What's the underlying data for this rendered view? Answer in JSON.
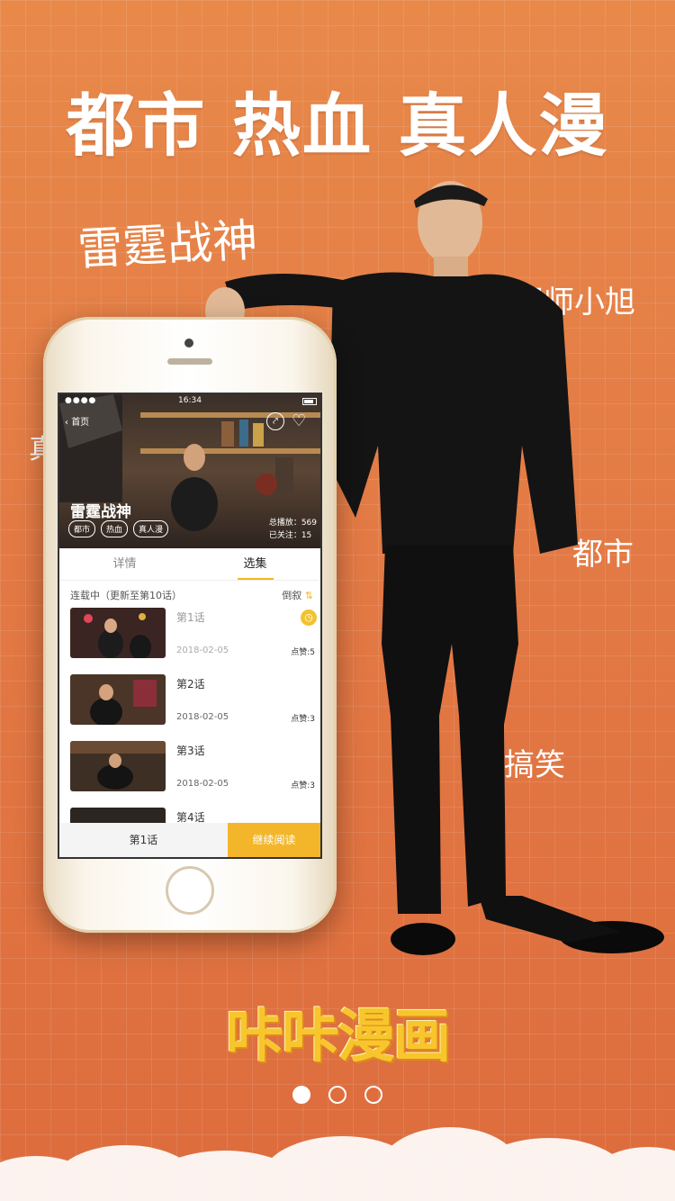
{
  "headline": "都市 热血 真人漫",
  "floating_tags": {
    "main": "雷霆战神",
    "a": "阴师小旭",
    "b": "都市",
    "c": "搞笑",
    "d": "真"
  },
  "phone_app": {
    "status_time": "16:34",
    "back_label": "首页",
    "title": "雷霆战神",
    "chips": [
      "都市",
      "热血",
      "真人漫"
    ],
    "total_plays": "总播放：569",
    "followers": "已关注：15",
    "tabs": [
      "详情",
      "选集"
    ],
    "serial_status": "连载中（更新至第10话）",
    "sort_label": "倒叙",
    "sort_icon": "⇅",
    "episodes": [
      {
        "title": "第1话",
        "date": "2018-02-05",
        "likes": "点赞:5"
      },
      {
        "title": "第2话",
        "date": "2018-02-05",
        "likes": "点赞:3"
      },
      {
        "title": "第3话",
        "date": "2018-02-05",
        "likes": "点赞:3"
      },
      {
        "title": "第4话",
        "date": "",
        "likes": ""
      }
    ],
    "bottom_left": "第1话",
    "bottom_right": "继续阅读"
  },
  "brand_logo": "咔咔漫画",
  "pagination": {
    "current": 1,
    "total": 3
  },
  "colors": {
    "background": "#e37a45",
    "accent": "#f3b62a",
    "logo": "#f7c62d"
  }
}
